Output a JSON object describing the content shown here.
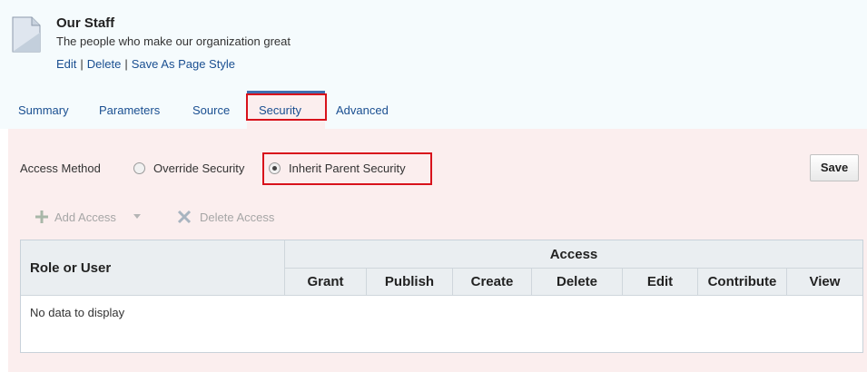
{
  "page": {
    "title": "Our Staff",
    "subtitle": "The people who make our organization great",
    "actions": [
      "Edit",
      "Delete",
      "Save As Page Style"
    ],
    "action_separator": "|"
  },
  "tabs": [
    "Summary",
    "Parameters",
    "Source",
    "Security",
    "Advanced"
  ],
  "active_tab": "Security",
  "security": {
    "access_method_label": "Access Method",
    "options": [
      {
        "label": "Override Security",
        "checked": false
      },
      {
        "label": "Inherit Parent Security",
        "checked": true
      }
    ],
    "save_label": "Save"
  },
  "toolbar": {
    "add_access": "Add Access",
    "delete_access": "Delete Access"
  },
  "table": {
    "role_header": "Role or User",
    "group_header": "Access",
    "columns": [
      "Grant",
      "Publish",
      "Create",
      "Delete",
      "Edit",
      "Contribute",
      "View"
    ],
    "empty_text": "No data to display"
  },
  "colors": {
    "link": "#1a4f91",
    "highlight": "#d8121b",
    "content_bg": "#fbeeee",
    "header_bg": "#f5fbfd"
  }
}
